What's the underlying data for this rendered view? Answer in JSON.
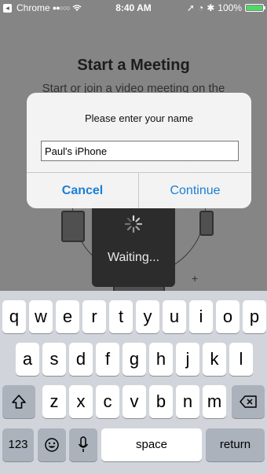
{
  "status_bar": {
    "back_app": "Chrome",
    "time": "8:40 AM",
    "battery": "100%",
    "battery_level": 1.0
  },
  "screen": {
    "title": "Start a Meeting",
    "subtitle": "Start or join a video meeting on the"
  },
  "hud": {
    "text": "Waiting..."
  },
  "alert": {
    "message": "Please enter your name",
    "input_value": "Paul's iPhone",
    "cancel_label": "Cancel",
    "continue_label": "Continue"
  },
  "keyboard": {
    "row1": [
      "q",
      "w",
      "e",
      "r",
      "t",
      "y",
      "u",
      "i",
      "o",
      "p"
    ],
    "row2": [
      "a",
      "s",
      "d",
      "f",
      "g",
      "h",
      "j",
      "k",
      "l"
    ],
    "row3": [
      "z",
      "x",
      "c",
      "v",
      "b",
      "n",
      "m"
    ],
    "numbers_label": "123",
    "space_label": "space",
    "return_label": "return",
    "shift_icon": "shift-icon",
    "delete_icon": "delete-icon",
    "emoji_icon": "emoji-icon",
    "mic_icon": "microphone-icon"
  },
  "colors": {
    "accent": "#1b7fd6",
    "battery": "#4cd964"
  }
}
